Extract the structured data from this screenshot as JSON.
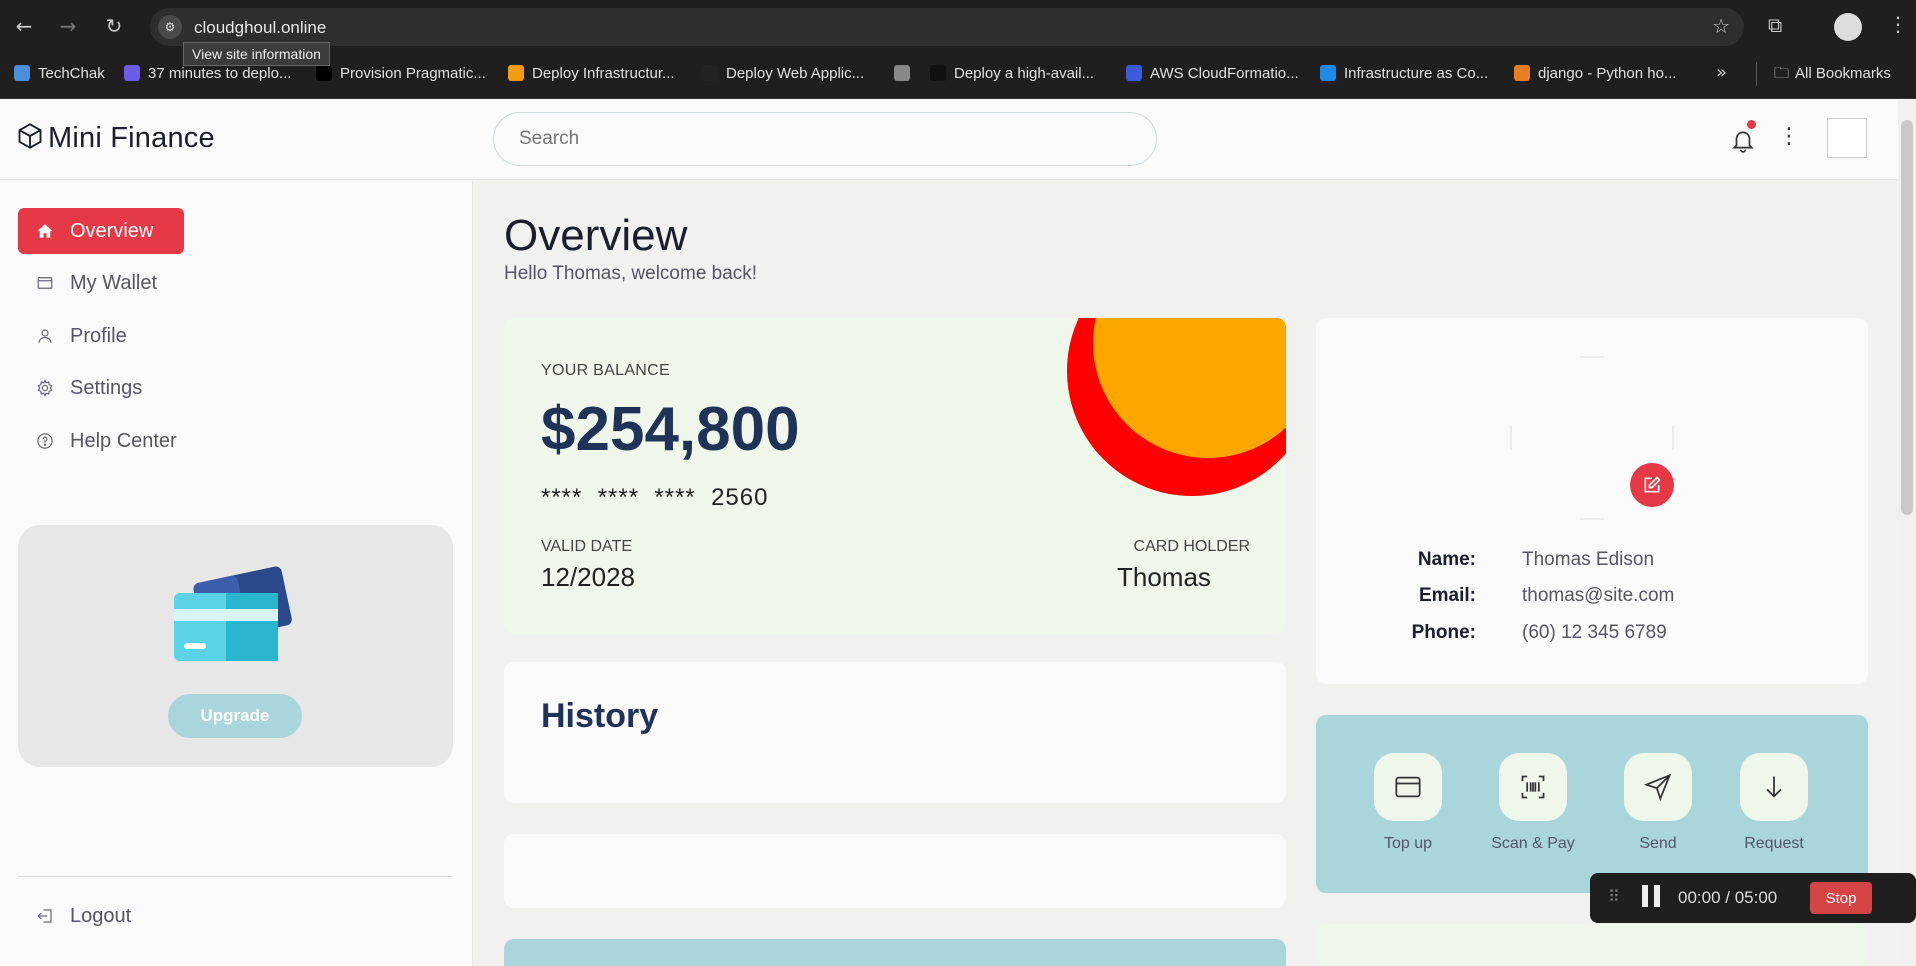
{
  "browser": {
    "url": "cloudghoul.online",
    "tooltip": "View site information",
    "bookmarks": [
      {
        "label": "TechChak",
        "color": "#4a90d9"
      },
      {
        "label": "37 minutes to deplo...",
        "color": "#6c5ce7"
      },
      {
        "label": "Provision Pragmatic...",
        "color": "#000000"
      },
      {
        "label": "Deploy Infrastructur...",
        "color": "#f39c12"
      },
      {
        "label": "Deploy Web Applic...",
        "color": "#222222"
      },
      {
        "label": "",
        "color": "#888888"
      },
      {
        "label": "Deploy a high-avail...",
        "color": "#111111"
      },
      {
        "label": "AWS CloudFormatio...",
        "color": "#3b5bdb"
      },
      {
        "label": "Infrastructure as Co...",
        "color": "#1e88e5"
      },
      {
        "label": "django - Python ho...",
        "color": "#e67e22"
      }
    ],
    "all_bookmarks": "All Bookmarks"
  },
  "app": {
    "brand": "Mini Finance",
    "search_placeholder": "Search",
    "accent": "#e63946",
    "sidebar": {
      "items": [
        {
          "label": "Overview",
          "icon": "home-icon",
          "active": true
        },
        {
          "label": "My Wallet",
          "icon": "wallet-icon",
          "active": false
        },
        {
          "label": "Profile",
          "icon": "user-icon",
          "active": false
        },
        {
          "label": "Settings",
          "icon": "gear-icon",
          "active": false
        },
        {
          "label": "Help Center",
          "icon": "help-icon",
          "active": false
        }
      ],
      "upgrade_label": "Upgrade",
      "logout_label": "Logout"
    },
    "page": {
      "title": "Overview",
      "subtitle": "Hello Thomas, welcome back!"
    },
    "balance": {
      "label": "YOUR BALANCE",
      "value": "$254,800",
      "card_number": "****  ****  ****  2560",
      "valid_label": "VALID DATE",
      "valid_value": "12/2028",
      "holder_label": "CARD HOLDER",
      "holder_value": "Thomas"
    },
    "history": {
      "title": "History"
    },
    "profile": {
      "name_label": "Name:",
      "name_value": "Thomas Edison",
      "email_label": "Email:",
      "email_value": "thomas@site.com",
      "phone_label": "Phone:",
      "phone_value": "(60) 12 345 6789"
    },
    "actions": [
      {
        "label": "Top up",
        "icon": "wallet-card-icon"
      },
      {
        "label": "Scan & Pay",
        "icon": "barcode-icon"
      },
      {
        "label": "Send",
        "icon": "send-icon"
      },
      {
        "label": "Request",
        "icon": "arrow-down-icon"
      }
    ]
  },
  "recorder": {
    "time": "00:00 / 05:00",
    "stop_label": "Stop"
  }
}
